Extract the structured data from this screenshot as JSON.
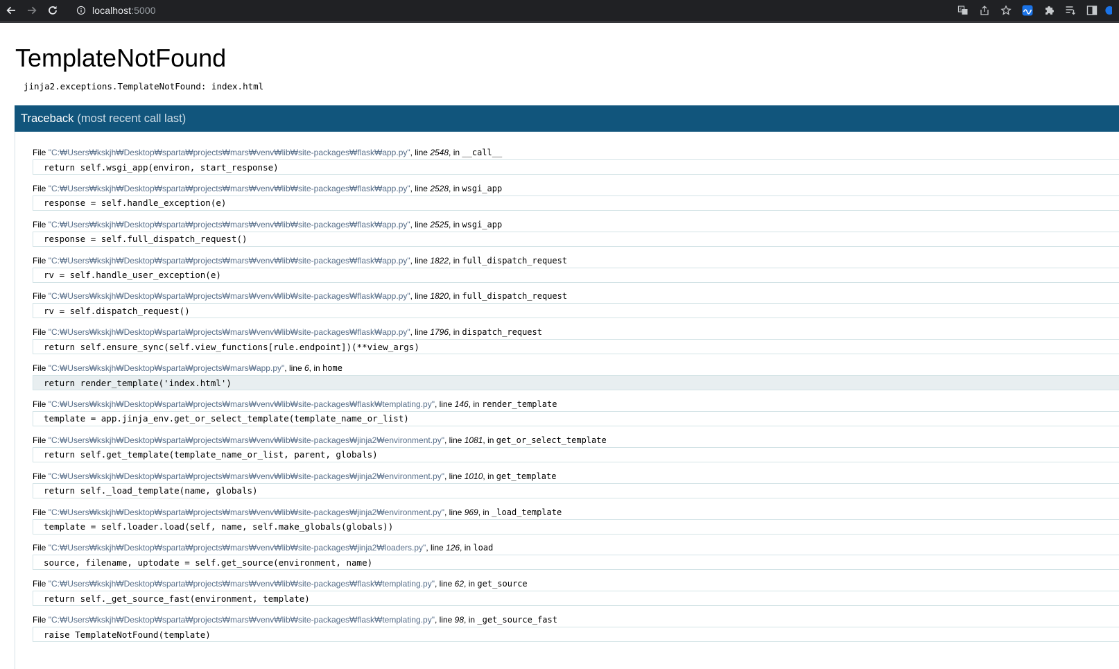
{
  "browser": {
    "url_host": "localhost",
    "url_port": ":5000",
    "icons": [
      "back-icon",
      "forward-icon",
      "reload-icon",
      "site-info-icon",
      "translate-icon",
      "share-icon",
      "bookmark-star-icon",
      "extension-wave-icon",
      "extensions-puzzle-icon",
      "reading-list-icon",
      "side-panel-icon"
    ]
  },
  "error": {
    "title": "TemplateNotFound",
    "message": "jinja2.exceptions.TemplateNotFound: index.html"
  },
  "traceback": {
    "heading": "Traceback",
    "subheading": "(most recent call last)",
    "file_label": "File",
    "line_label": "line",
    "in_label": "in",
    "frames": [
      {
        "file": "\"C:₩Users₩kskjh₩Desktop₩sparta₩projects₩mars₩venv₩lib₩site-packages₩flask₩app.py\"",
        "line": "2548",
        "func": "__call__",
        "code": "return self.wsgi_app(environ, start_response)"
      },
      {
        "file": "\"C:₩Users₩kskjh₩Desktop₩sparta₩projects₩mars₩venv₩lib₩site-packages₩flask₩app.py\"",
        "line": "2528",
        "func": "wsgi_app",
        "code": "response = self.handle_exception(e)"
      },
      {
        "file": "\"C:₩Users₩kskjh₩Desktop₩sparta₩projects₩mars₩venv₩lib₩site-packages₩flask₩app.py\"",
        "line": "2525",
        "func": "wsgi_app",
        "code": "response = self.full_dispatch_request()"
      },
      {
        "file": "\"C:₩Users₩kskjh₩Desktop₩sparta₩projects₩mars₩venv₩lib₩site-packages₩flask₩app.py\"",
        "line": "1822",
        "func": "full_dispatch_request",
        "code": "rv = self.handle_user_exception(e)"
      },
      {
        "file": "\"C:₩Users₩kskjh₩Desktop₩sparta₩projects₩mars₩venv₩lib₩site-packages₩flask₩app.py\"",
        "line": "1820",
        "func": "full_dispatch_request",
        "code": "rv = self.dispatch_request()"
      },
      {
        "file": "\"C:₩Users₩kskjh₩Desktop₩sparta₩projects₩mars₩venv₩lib₩site-packages₩flask₩app.py\"",
        "line": "1796",
        "func": "dispatch_request",
        "code": "return self.ensure_sync(self.view_functions[rule.endpoint])(**view_args)"
      },
      {
        "file": "\"C:₩Users₩kskjh₩Desktop₩sparta₩projects₩mars₩app.py\"",
        "line": "6",
        "func": "home",
        "code": "return render_template('index.html')"
      },
      {
        "file": "\"C:₩Users₩kskjh₩Desktop₩sparta₩projects₩mars₩venv₩lib₩site-packages₩flask₩templating.py\"",
        "line": "146",
        "func": "render_template",
        "code": "template = app.jinja_env.get_or_select_template(template_name_or_list)"
      },
      {
        "file": "\"C:₩Users₩kskjh₩Desktop₩sparta₩projects₩mars₩venv₩lib₩site-packages₩jinja2₩environment.py\"",
        "line": "1081",
        "func": "get_or_select_template",
        "code": "return self.get_template(template_name_or_list, parent, globals)"
      },
      {
        "file": "\"C:₩Users₩kskjh₩Desktop₩sparta₩projects₩mars₩venv₩lib₩site-packages₩jinja2₩environment.py\"",
        "line": "1010",
        "func": "get_template",
        "code": "return self._load_template(name, globals)"
      },
      {
        "file": "\"C:₩Users₩kskjh₩Desktop₩sparta₩projects₩mars₩venv₩lib₩site-packages₩jinja2₩environment.py\"",
        "line": "969",
        "func": "_load_template",
        "code": "template = self.loader.load(self, name, self.make_globals(globals))"
      },
      {
        "file": "\"C:₩Users₩kskjh₩Desktop₩sparta₩projects₩mars₩venv₩lib₩site-packages₩jinja2₩loaders.py\"",
        "line": "126",
        "func": "load",
        "code": "source, filename, uptodate = self.get_source(environment, name)"
      },
      {
        "file": "\"C:₩Users₩kskjh₩Desktop₩sparta₩projects₩mars₩venv₩lib₩site-packages₩flask₩templating.py\"",
        "line": "62",
        "func": "get_source",
        "code": "return self._get_source_fast(environment, template)"
      },
      {
        "file": "\"C:₩Users₩kskjh₩Desktop₩sparta₩projects₩mars₩venv₩lib₩site-packages₩flask₩templating.py\"",
        "line": "98",
        "func": "_get_source_fast",
        "code": "raise TemplateNotFound(template)"
      }
    ]
  },
  "colors": {
    "chrome_bg": "#202124",
    "traceback_header": "#11557c",
    "file_path": "#586f8a",
    "code_border": "#d3e3e6",
    "current_line_bg": "#e8eef0"
  }
}
